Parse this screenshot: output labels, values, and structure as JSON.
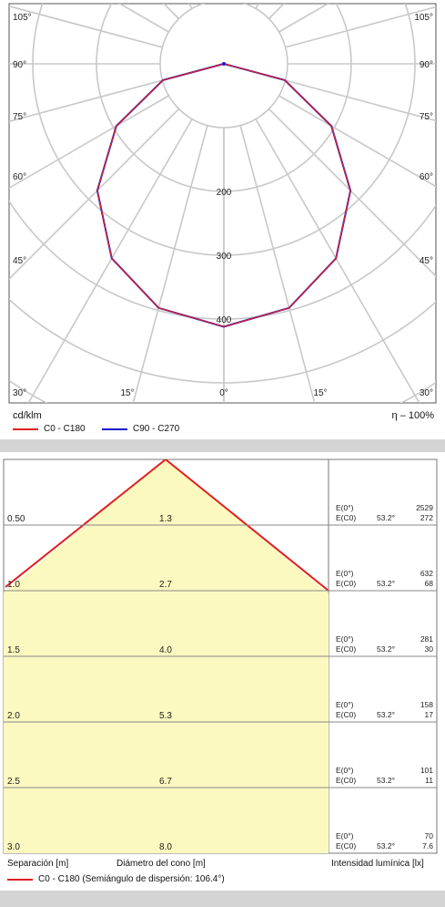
{
  "polar": {
    "type": "polar",
    "unit_label": "cd/klm",
    "efficiency_label": "η – 100%",
    "angle_labels_left": [
      "105°",
      "90°",
      "75°",
      "60°",
      "45°",
      "30°"
    ],
    "angle_labels_right": [
      "105°",
      "90°",
      "75°",
      "60°",
      "45°",
      "30°"
    ],
    "angle_labels_bottom": [
      "15°",
      "0°",
      "15°"
    ],
    "radial_labels": [
      "200",
      "300",
      "400"
    ],
    "legend": [
      {
        "name": "C0 - C180",
        "color": "#e02020"
      },
      {
        "name": "C90 - C270",
        "color": "#1a1acc"
      }
    ],
    "series": [
      {
        "name": "C90 - C270",
        "color": "#1a1acc",
        "angles_deg": [
          0,
          15,
          30,
          45,
          60,
          75,
          90
        ],
        "intensity_cd_klm": [
          412,
          396,
          352,
          281,
          195,
          99,
          0
        ]
      },
      {
        "name": "C0 - C180",
        "color": "#e02020",
        "angles_deg": [
          0,
          15,
          30,
          45,
          60,
          75,
          90
        ],
        "intensity_cd_klm": [
          412,
          396,
          352,
          281,
          195,
          99,
          0
        ]
      }
    ]
  },
  "cone": {
    "type": "table",
    "rows": [
      {
        "separation": "0.50",
        "diameter": "1.3",
        "e0_label": "E(0°)",
        "ec0_label": "E(C0)",
        "angle": "53.2°",
        "e0": "2529",
        "ec0": "272"
      },
      {
        "separation": "1.0",
        "diameter": "2.7",
        "e0_label": "E(0°)",
        "ec0_label": "E(C0)",
        "angle": "53.2°",
        "e0": "632",
        "ec0": "68"
      },
      {
        "separation": "1.5",
        "diameter": "4.0",
        "e0_label": "E(0°)",
        "ec0_label": "E(C0)",
        "angle": "53.2°",
        "e0": "281",
        "ec0": "30"
      },
      {
        "separation": "2.0",
        "diameter": "5.3",
        "e0_label": "E(0°)",
        "ec0_label": "E(C0)",
        "angle": "53.2°",
        "e0": "158",
        "ec0": "17"
      },
      {
        "separation": "2.5",
        "diameter": "6.7",
        "e0_label": "E(0°)",
        "ec0_label": "E(C0)",
        "angle": "53.2°",
        "e0": "101",
        "ec0": "11"
      },
      {
        "separation": "3.0",
        "diameter": "8.0",
        "e0_label": "E(0°)",
        "ec0_label": "E(C0)",
        "angle": "53.2°",
        "e0": "70",
        "ec0": "7.6"
      }
    ],
    "col_separation_label": "Separación [m]",
    "col_diameter_label": "Diámetro del cono [m]",
    "col_intensity_label": "Intensidad lumínica [lx]",
    "legend_label": "C0 - C180 (Semiángulo de dispersión: 106.4°)",
    "legend_color": "#e02020",
    "fill_color": "#fbf9bf"
  }
}
